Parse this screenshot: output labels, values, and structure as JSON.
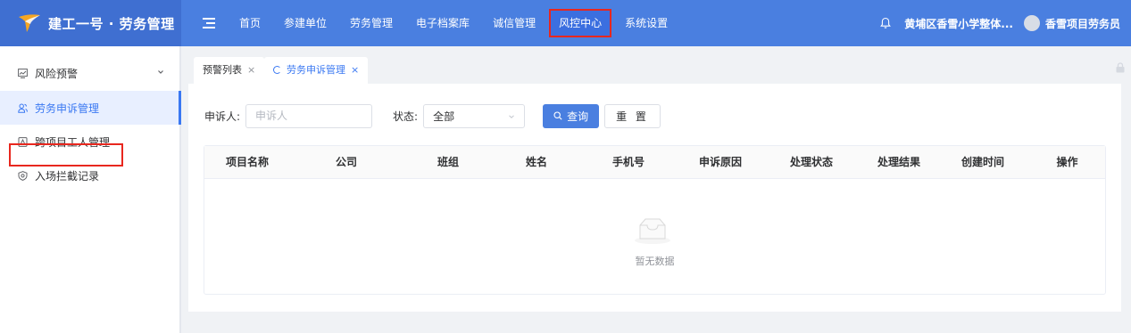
{
  "app": {
    "title": "建工一号 · 劳务管理",
    "logo_icon": "brand-logo-icon",
    "colors": {
      "header": "#4a7fe0",
      "brand_block": "#3f6fd1",
      "accent": "#3a78f2",
      "highlight": "#e8271e"
    }
  },
  "nav": {
    "items": [
      {
        "label": "首页"
      },
      {
        "label": "参建单位"
      },
      {
        "label": "劳务管理"
      },
      {
        "label": "电子档案库"
      },
      {
        "label": "诚信管理"
      },
      {
        "label": "风控中心",
        "active": true
      },
      {
        "label": "系统设置"
      }
    ]
  },
  "header_right": {
    "org": "黄埔区香雪小学整体...",
    "user": "香雪项目劳务员"
  },
  "sidebar": {
    "group_label": "风险预警",
    "items": [
      {
        "label": "劳务申诉管理",
        "active": true
      },
      {
        "label": "跨项目工人管理"
      },
      {
        "label": "入场拦截记录"
      }
    ]
  },
  "tabs": [
    {
      "label": "预警列表",
      "close": "×"
    },
    {
      "label": "劳务申诉管理",
      "close": "×",
      "active": true
    }
  ],
  "filters": {
    "complainant_label": "申诉人:",
    "complainant_placeholder": "申诉人",
    "status_label": "状态:",
    "status_value": "全部",
    "search_button": "查询",
    "reset_button": "重 置"
  },
  "table": {
    "columns": [
      "项目名称",
      "公司",
      "班组",
      "姓名",
      "手机号",
      "申诉原因",
      "处理状态",
      "处理结果",
      "创建时间",
      "操作"
    ],
    "rows": [],
    "empty_text": "暂无数据"
  }
}
